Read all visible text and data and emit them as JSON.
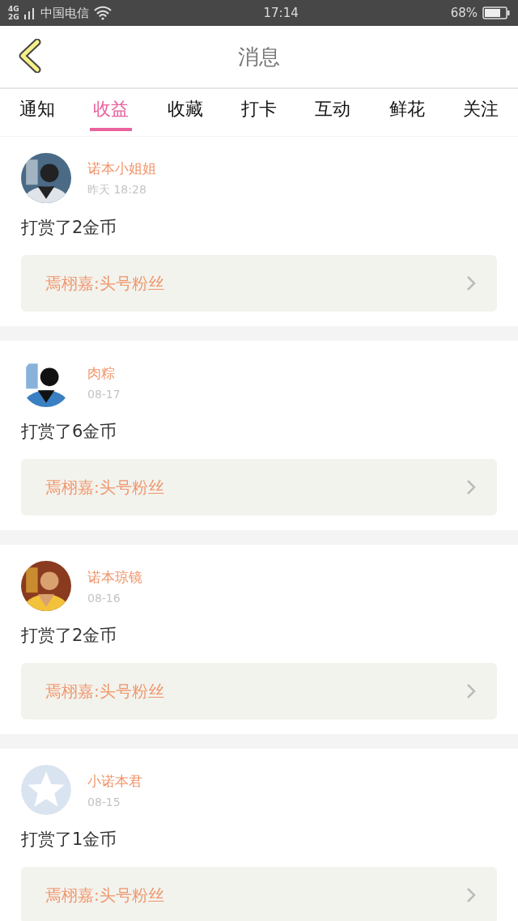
{
  "status_bar": {
    "network_top": "4G",
    "network_bottom": "2G",
    "carrier": "中国电信",
    "time": "17:14",
    "battery": "68%"
  },
  "header": {
    "title": "消息"
  },
  "tabs": [
    {
      "label": "通知",
      "selected": false
    },
    {
      "label": "收益",
      "selected": true
    },
    {
      "label": "收藏",
      "selected": false
    },
    {
      "label": "打卡",
      "selected": false
    },
    {
      "label": "互动",
      "selected": false
    },
    {
      "label": "鲜花",
      "selected": false
    },
    {
      "label": "关注",
      "selected": false
    }
  ],
  "messages": [
    {
      "name": "诺本小姐姐",
      "time": "昨天 18:28",
      "text": "打赏了2金币",
      "link": "焉栩嘉:头号粉丝"
    },
    {
      "name": "肉粽",
      "time": "08-17",
      "text": "打赏了6金币",
      "link": "焉栩嘉:头号粉丝"
    },
    {
      "name": "诺本琼镜",
      "time": "08-16",
      "text": "打赏了2金币",
      "link": "焉栩嘉:头号粉丝"
    },
    {
      "avatar": {
        "kind": "default"
      },
      "name": "小诺本君",
      "time": "08-15",
      "text": "打赏了1金币",
      "link": "焉栩嘉:头号粉丝"
    }
  ]
}
